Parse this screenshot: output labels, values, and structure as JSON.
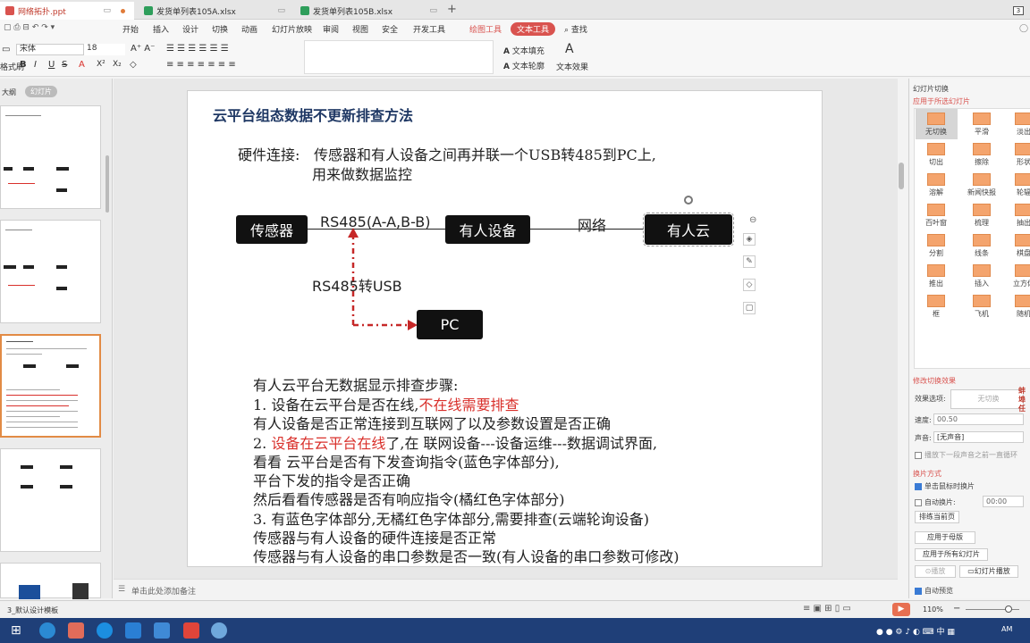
{
  "tabs": [
    {
      "label": "网络拓扑.ppt",
      "color": "#d9534f"
    },
    {
      "label": "发货单列表105A.xlsx",
      "color": "#2e9e5b"
    },
    {
      "label": "发货单列表105B.xlsx",
      "color": "#2e9e5b"
    }
  ],
  "tab_add": "+",
  "window_badge": "3",
  "menu": {
    "items": [
      "开始",
      "插入",
      "设计",
      "切换",
      "动画",
      "幻灯片放映",
      "审阅",
      "视图",
      "安全",
      "开发工具",
      "绘图工具",
      "文本工具"
    ],
    "search": "查找",
    "active": "文本工具",
    "highlight": "绘图工具"
  },
  "toolbar": {
    "font_name": "宋体",
    "font_size": "18",
    "format_painter": "格式刷",
    "text_fill": "文本填充",
    "text_outline": "文本轮廓",
    "text_effect": "文本效果"
  },
  "left_panel": {
    "tab_outline": "大纲",
    "tab_slides": "幻灯片"
  },
  "slide": {
    "title": "云平台组态数据不更新排查方法",
    "hw_label": "硬件连接:",
    "hw_line1": "传感器和有人设备之间再并联一个USB转485到PC上,",
    "hw_line2": "用来做数据监控",
    "box_sensor": "传感器",
    "box_device": "有人设备",
    "box_cloud": "有人云",
    "box_pc": "PC",
    "label_rs485": "RS485(A-A,B-B)",
    "label_network": "网络",
    "label_usb": "RS485转USB",
    "steps_title": "有人云平台无数据显示排查步骤:",
    "s1a": "1. 设备在云平台是否在线,",
    "s1b": "不在线需要排查",
    "s1c": "有人设备是否正常连接到互联网了以及参数设置是否正确",
    "s2a": "2.",
    "s2b": " 设备在云平台在线",
    "s2c": "了,在 联网设备---设备运维---数据调试界面,",
    "s2d": "看看 云平台是否有下发查询指令(蓝色字体部分),",
    "s2e": "平台下发的指令是否正确",
    "s2f": "然后看看传感器是否有响应指令(橘红色字体部分)",
    "s3a": "3. 有蓝色字体部分,无橘红色字体部分,需要排查(云端轮询设备)",
    "s3b": "传感器与有人设备的硬件连接是否正常",
    "s3c": "传感器与有人设备的串口参数是否一致(有人设备的串口参数可修改)"
  },
  "right_panel": {
    "header": "幻灯片切换",
    "apply_selected": "应用于所选幻灯片",
    "transitions": [
      "无切换",
      "平滑",
      "淡出",
      "切出",
      "擦除",
      "形状",
      "溶解",
      "新闻快报",
      "轮辐",
      "百叶窗",
      "梳理",
      "抽出",
      "分割",
      "线条",
      "棋盘",
      "推出",
      "插入",
      "立方体",
      "框",
      "飞机",
      "随机"
    ],
    "modify": "修改切换效果",
    "effect_label": "效果选项:",
    "effect_value": "无切换",
    "speed_label": "速度:",
    "speed_value": "00.50",
    "sound_label": "声音:",
    "sound_value": "[无声音]",
    "loop_label": "播放下一段声音之前一直循环",
    "advance": "换片方式",
    "on_click": "单击鼠标时换片",
    "auto_label": "自动换片:",
    "auto_value": "00:00",
    "rehearse": "排练当前页",
    "apply_master": "应用于母版",
    "apply_all": "应用于所有幻灯片",
    "play": "播放",
    "slideshow": "幻灯片播放",
    "auto_preview": "自动预览",
    "side_text": "蚌埠任"
  },
  "notes": "单击此处添加备注",
  "status": {
    "template": "3_默认设计模板",
    "zoom": "110%"
  },
  "taskbar": {
    "time": "AM"
  }
}
